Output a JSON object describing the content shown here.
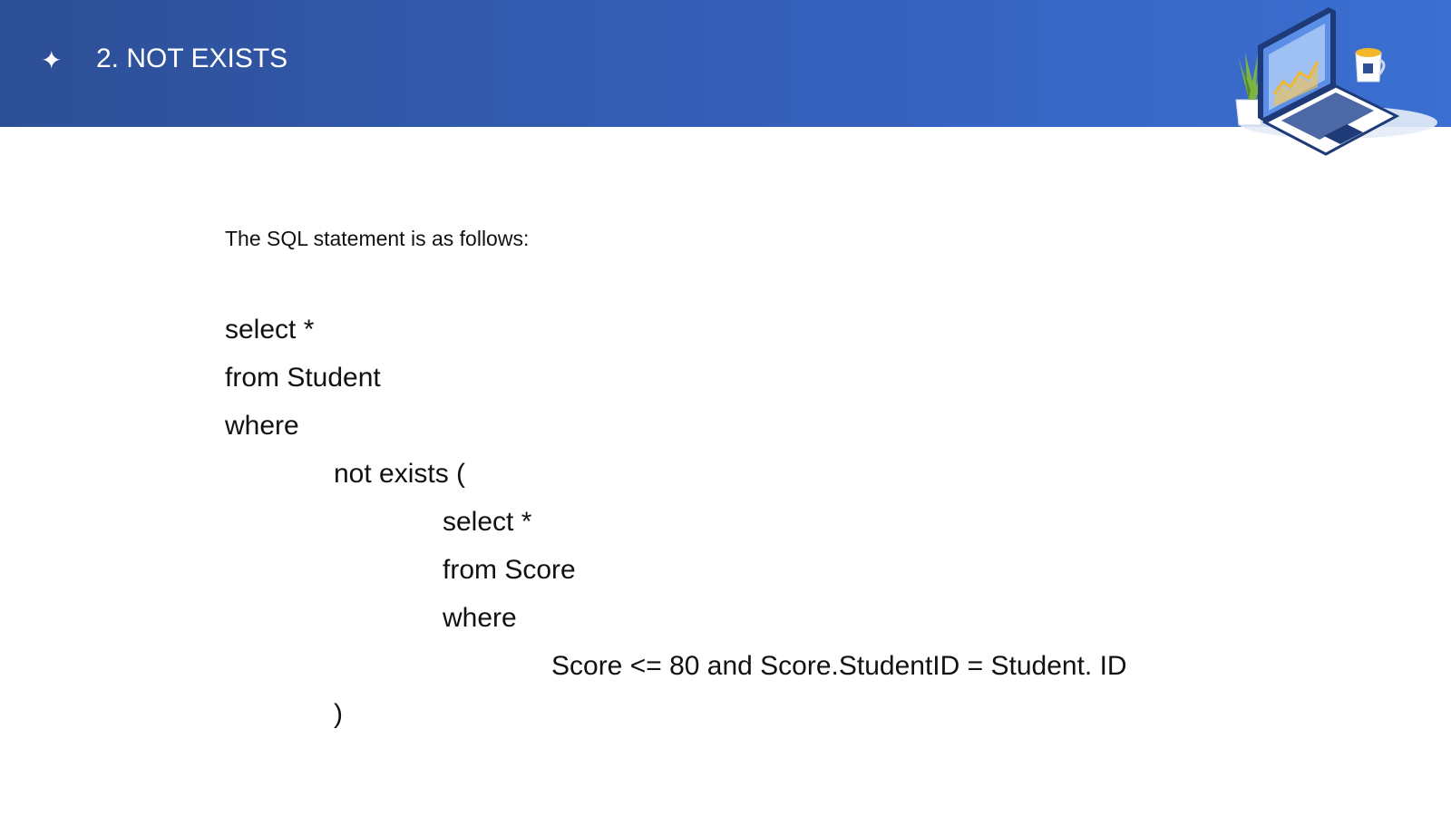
{
  "header": {
    "icon": "sparkle-star-icon",
    "title": "2. NOT EXISTS",
    "illustration": "laptop-with-plant-and-mug-illustration"
  },
  "content": {
    "intro": "The SQL statement is as follows:",
    "code_lines": [
      "select *",
      "from Student",
      "where",
      "not exists (",
      "select *",
      "from Score",
      "where",
      "Score <= 80 and Score.StudentID = Student. ID",
      ")"
    ]
  },
  "colors": {
    "header_start": "#2d4f96",
    "header_end": "#3b6fd2",
    "text": "#111111",
    "header_text": "#ffffff"
  }
}
